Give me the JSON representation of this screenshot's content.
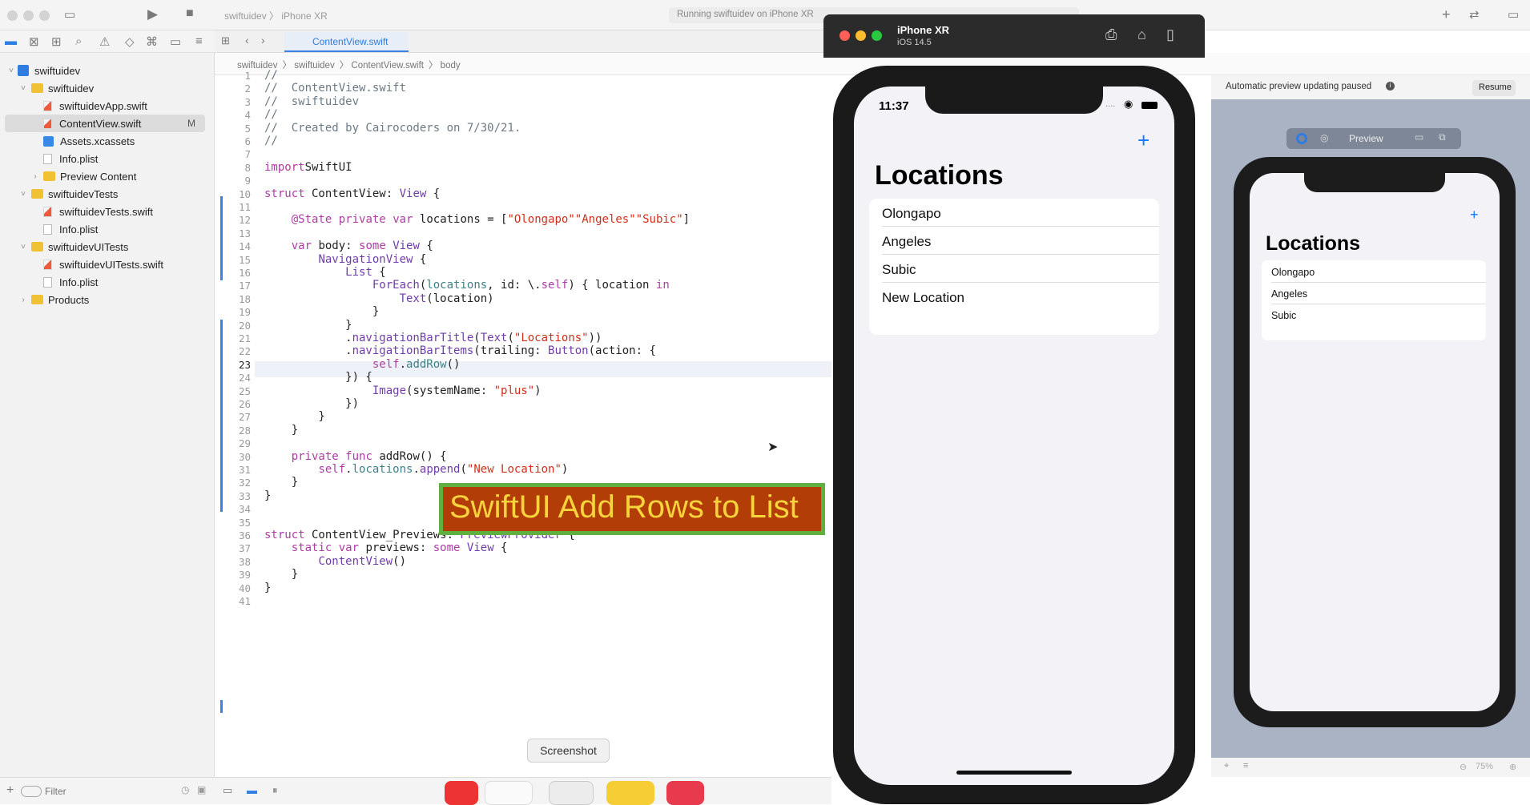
{
  "toolbar": {
    "scheme": "swiftuidev",
    "device": "iPhone XR",
    "status": "Running swiftuidev on iPhone XR"
  },
  "tab": {
    "label": "ContentView.swift"
  },
  "jumpbar": [
    "swiftuidev",
    "swiftuidev",
    "ContentView.swift",
    "body"
  ],
  "navigator": {
    "items": [
      {
        "label": "swiftuidev",
        "kind": "project",
        "indent": 0,
        "chev": "˅"
      },
      {
        "label": "swiftuidev",
        "kind": "folder",
        "indent": 1,
        "chev": "˅"
      },
      {
        "label": "swiftuidevApp.swift",
        "kind": "swift",
        "indent": 2,
        "chev": ""
      },
      {
        "label": "ContentView.swift",
        "kind": "swift",
        "indent": 2,
        "chev": "",
        "selected": true,
        "badge": "M"
      },
      {
        "label": "Assets.xcassets",
        "kind": "assets",
        "indent": 2,
        "chev": ""
      },
      {
        "label": "Info.plist",
        "kind": "plist",
        "indent": 2,
        "chev": ""
      },
      {
        "label": "Preview Content",
        "kind": "folder",
        "indent": 2,
        "chev": "›"
      },
      {
        "label": "swiftuidevTests",
        "kind": "folder",
        "indent": 1,
        "chev": "˅"
      },
      {
        "label": "swiftuidevTests.swift",
        "kind": "swift",
        "indent": 2,
        "chev": ""
      },
      {
        "label": "Info.plist",
        "kind": "plist",
        "indent": 2,
        "chev": ""
      },
      {
        "label": "swiftuidevUITests",
        "kind": "folder",
        "indent": 1,
        "chev": "˅"
      },
      {
        "label": "swiftuidevUITests.swift",
        "kind": "swift",
        "indent": 2,
        "chev": ""
      },
      {
        "label": "Info.plist",
        "kind": "plist",
        "indent": 2,
        "chev": ""
      },
      {
        "label": "Products",
        "kind": "folder",
        "indent": 1,
        "chev": "›"
      }
    ],
    "filter_placeholder": "Filter"
  },
  "editor": {
    "current_line": 23,
    "lines": [
      [
        [
          "cm",
          "//"
        ]
      ],
      [
        [
          "cm",
          "//  ContentView.swift"
        ]
      ],
      [
        [
          "cm",
          "//  swiftuidev"
        ]
      ],
      [
        [
          "cm",
          "//"
        ]
      ],
      [
        [
          "cm",
          "//  Created by Cairocoders on 7/30/21."
        ]
      ],
      [
        [
          "cm",
          "//"
        ]
      ],
      [],
      [
        [
          "kw",
          "import"
        ],
        [
          "",
          "SwiftUI"
        ]
      ],
      [],
      [
        [
          "kw",
          "struct"
        ],
        [
          "",
          " ContentView: "
        ],
        [
          "ty",
          "View"
        ],
        [
          "",
          " {"
        ]
      ],
      [],
      [
        [
          "",
          "    "
        ],
        [
          "kw",
          "@State"
        ],
        [
          "",
          " "
        ],
        [
          "kw",
          "private"
        ],
        [
          "",
          " "
        ],
        [
          "kw",
          "var"
        ],
        [
          "",
          " locations = ["
        ],
        [
          "st",
          "\"Olongapo\""
        ],
        [
          ", "
        ],
        [
          "st",
          "\"Angeles\""
        ],
        [
          ", "
        ],
        [
          "st",
          "\"Subic\""
        ],
        [
          "",
          "]"
        ]
      ],
      [],
      [
        [
          "",
          "    "
        ],
        [
          "kw",
          "var"
        ],
        [
          "",
          " body: "
        ],
        [
          "kw",
          "some"
        ],
        [
          "",
          " "
        ],
        [
          "ty",
          "View"
        ],
        [
          "",
          " {"
        ]
      ],
      [
        [
          "",
          "        "
        ],
        [
          "ty",
          "NavigationView"
        ],
        [
          "",
          " {"
        ]
      ],
      [
        [
          "",
          "            "
        ],
        [
          "ty",
          "List"
        ],
        [
          "",
          " {"
        ]
      ],
      [
        [
          "",
          "                "
        ],
        [
          "ty",
          "ForEach"
        ],
        [
          "",
          "("
        ],
        [
          "fn",
          "locations"
        ],
        [
          "",
          ", id: \\."
        ],
        [
          "kw",
          "self"
        ],
        [
          "",
          ") { location "
        ],
        [
          "kw",
          "in"
        ]
      ],
      [
        [
          "",
          "                    "
        ],
        [
          "ty",
          "Text"
        ],
        [
          "",
          "(location)"
        ]
      ],
      [
        [
          "",
          "                }"
        ]
      ],
      [
        [
          "",
          "            }"
        ]
      ],
      [
        [
          "",
          "            ."
        ],
        [
          "ty",
          "navigationBarTitle"
        ],
        [
          "",
          "("
        ],
        [
          "ty",
          "Text"
        ],
        [
          "",
          "("
        ],
        [
          "st",
          "\"Locations\""
        ],
        [
          "",
          "))"
        ]
      ],
      [
        [
          "",
          "            ."
        ],
        [
          "ty",
          "navigationBarItems"
        ],
        [
          "",
          "(trailing: "
        ],
        [
          "ty",
          "Button"
        ],
        [
          "",
          "(action: {"
        ]
      ],
      [
        [
          "",
          "                "
        ],
        [
          "kw",
          "self"
        ],
        [
          "",
          "."
        ],
        [
          "fn",
          "addRow"
        ],
        [
          "",
          "()"
        ]
      ],
      [
        [
          "",
          "            }) {"
        ]
      ],
      [
        [
          "",
          "                "
        ],
        [
          "ty",
          "Image"
        ],
        [
          "",
          "(systemName: "
        ],
        [
          "st",
          "\"plus\""
        ],
        [
          "",
          ")"
        ]
      ],
      [
        [
          "",
          "            })"
        ]
      ],
      [
        [
          "",
          "        }"
        ]
      ],
      [
        [
          "",
          "    }"
        ]
      ],
      [],
      [
        [
          "",
          "    "
        ],
        [
          "kw",
          "private"
        ],
        [
          "",
          " "
        ],
        [
          "kw",
          "func"
        ],
        [
          "",
          " addRow() {"
        ]
      ],
      [
        [
          "",
          "        "
        ],
        [
          "kw",
          "self"
        ],
        [
          "",
          "."
        ],
        [
          "fn",
          "locations"
        ],
        [
          "",
          "."
        ],
        [
          "ty",
          "append"
        ],
        [
          "",
          "("
        ],
        [
          "st",
          "\"New Location\""
        ],
        [
          "",
          ")"
        ]
      ],
      [
        [
          "",
          "    }"
        ]
      ],
      [
        [
          "",
          "}"
        ]
      ],
      [],
      [],
      [
        [
          "kw",
          "struct"
        ],
        [
          "",
          " ContentView_Previews: "
        ],
        [
          "ty",
          "PreviewProvider"
        ],
        [
          "",
          " {"
        ]
      ],
      [
        [
          "",
          "    "
        ],
        [
          "kw",
          "static"
        ],
        [
          "",
          " "
        ],
        [
          "kw",
          "var"
        ],
        [
          "",
          " previews: "
        ],
        [
          "kw",
          "some"
        ],
        [
          "",
          " "
        ],
        [
          "ty",
          "View"
        ],
        [
          "",
          " {"
        ]
      ],
      [
        [
          "",
          "        "
        ],
        [
          "ty",
          "ContentView"
        ],
        [
          "",
          "()"
        ]
      ],
      [
        [
          "",
          "    }"
        ]
      ],
      [
        [
          "",
          "}"
        ]
      ],
      []
    ]
  },
  "banner": {
    "text": "SwiftUI Add Rows to List"
  },
  "simulator": {
    "device": "iPhone XR",
    "os": "iOS 14.5",
    "time": "11:37",
    "title": "Locations",
    "plus": "+",
    "items": [
      "Olongapo",
      "Angeles",
      "Subic",
      "New Location"
    ]
  },
  "canvas": {
    "status": "Automatic preview updating paused",
    "resume": "Resume",
    "preview_label": "Preview",
    "title": "Locations",
    "plus": "+",
    "items": [
      "Olongapo",
      "Angeles",
      "Subic"
    ],
    "zoom": "75%"
  },
  "tooltip": {
    "text": "Screenshot"
  },
  "colors": {
    "accent": "#1677ff",
    "banner_bg": "#b23d07",
    "banner_fg": "#f7d33c",
    "banner_border": "#5fb041"
  }
}
